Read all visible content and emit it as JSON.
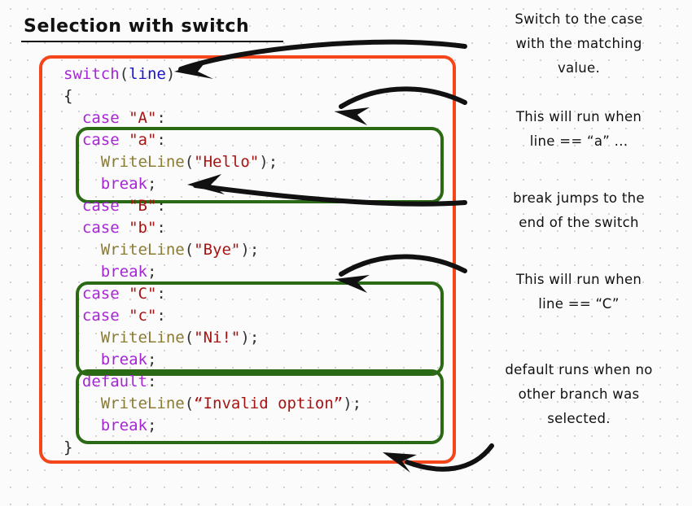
{
  "page": {
    "title": "Selection with switch",
    "background": "#fbfbfb",
    "grid_dot_color": "#cfcfcf"
  },
  "colors": {
    "outer_box_stroke": "#f4451b",
    "inner_box_stroke": "#2a6a14",
    "arrow": "#111111",
    "keyword": "#a626d4",
    "variable": "#1a13c8",
    "function": "#8a7b33",
    "string": "#a61414",
    "punctuation": "#333333",
    "text": "#111111"
  },
  "code": {
    "lines": [
      {
        "indent": 0,
        "tokens": [
          {
            "t": "switch",
            "c": "kw"
          },
          {
            "t": "(",
            "c": "pun"
          },
          {
            "t": "line",
            "c": "var"
          },
          {
            "t": ")",
            "c": "pun"
          }
        ]
      },
      {
        "indent": 0,
        "tokens": [
          {
            "t": "{",
            "c": "brace"
          }
        ]
      },
      {
        "indent": 1,
        "tokens": [
          {
            "t": "case ",
            "c": "kw"
          },
          {
            "t": "\"A\"",
            "c": "str"
          },
          {
            "t": ":",
            "c": "pun"
          }
        ]
      },
      {
        "indent": 1,
        "tokens": [
          {
            "t": "case ",
            "c": "kw"
          },
          {
            "t": "\"a\"",
            "c": "str"
          },
          {
            "t": ":",
            "c": "pun"
          }
        ]
      },
      {
        "indent": 2,
        "tokens": [
          {
            "t": "WriteLine",
            "c": "fn"
          },
          {
            "t": "(",
            "c": "pun"
          },
          {
            "t": "\"Hello\"",
            "c": "str"
          },
          {
            "t": ")",
            "c": "pun"
          },
          {
            "t": ";",
            "c": "pun"
          }
        ]
      },
      {
        "indent": 2,
        "tokens": [
          {
            "t": "break",
            "c": "kw"
          },
          {
            "t": ";",
            "c": "pun"
          }
        ]
      },
      {
        "indent": 1,
        "tokens": [
          {
            "t": "case ",
            "c": "kw"
          },
          {
            "t": "\"B\"",
            "c": "str"
          },
          {
            "t": ":",
            "c": "pun"
          }
        ]
      },
      {
        "indent": 1,
        "tokens": [
          {
            "t": "case ",
            "c": "kw"
          },
          {
            "t": "\"b\"",
            "c": "str"
          },
          {
            "t": ":",
            "c": "pun"
          }
        ]
      },
      {
        "indent": 2,
        "tokens": [
          {
            "t": "WriteLine",
            "c": "fn"
          },
          {
            "t": "(",
            "c": "pun"
          },
          {
            "t": "\"Bye\"",
            "c": "str"
          },
          {
            "t": ")",
            "c": "pun"
          },
          {
            "t": ";",
            "c": "pun"
          }
        ]
      },
      {
        "indent": 2,
        "tokens": [
          {
            "t": "break",
            "c": "kw"
          },
          {
            "t": ";",
            "c": "pun"
          }
        ]
      },
      {
        "indent": 1,
        "tokens": [
          {
            "t": "case ",
            "c": "kw"
          },
          {
            "t": "\"C\"",
            "c": "str"
          },
          {
            "t": ":",
            "c": "pun"
          }
        ]
      },
      {
        "indent": 1,
        "tokens": [
          {
            "t": "case ",
            "c": "kw"
          },
          {
            "t": "\"c\"",
            "c": "str"
          },
          {
            "t": ":",
            "c": "pun"
          }
        ]
      },
      {
        "indent": 2,
        "tokens": [
          {
            "t": "WriteLine",
            "c": "fn"
          },
          {
            "t": "(",
            "c": "pun"
          },
          {
            "t": "\"Ni!\"",
            "c": "str"
          },
          {
            "t": ")",
            "c": "pun"
          },
          {
            "t": ";",
            "c": "pun"
          }
        ]
      },
      {
        "indent": 2,
        "tokens": [
          {
            "t": "break",
            "c": "kw"
          },
          {
            "t": ";",
            "c": "pun"
          }
        ]
      },
      {
        "indent": 1,
        "tokens": [
          {
            "t": "default",
            "c": "kw"
          },
          {
            "t": ":",
            "c": "pun"
          }
        ]
      },
      {
        "indent": 2,
        "tokens": [
          {
            "t": "WriteLine",
            "c": "fn"
          },
          {
            "t": "(",
            "c": "pun"
          },
          {
            "t": "“Invalid option”",
            "c": "str"
          },
          {
            "t": ")",
            "c": "pun"
          },
          {
            "t": ";",
            "c": "pun"
          }
        ]
      },
      {
        "indent": 2,
        "tokens": [
          {
            "t": "break",
            "c": "kw"
          },
          {
            "t": ";",
            "c": "pun"
          }
        ]
      },
      {
        "indent": 0,
        "tokens": [
          {
            "t": "}",
            "c": "brace"
          }
        ]
      }
    ]
  },
  "annotations": [
    {
      "id": "note-switch",
      "lines": [
        "Switch to the case",
        "with the matching",
        "value."
      ]
    },
    {
      "id": "note-casea",
      "lines": [
        "This will run when",
        "line ==  “a” ..."
      ]
    },
    {
      "id": "note-break",
      "lines": [
        "break jumps to the",
        "end of the switch"
      ]
    },
    {
      "id": "note-casec",
      "lines": [
        "This will run when",
        "line ==  “C”"
      ]
    },
    {
      "id": "note-default",
      "lines": [
        "default runs when no",
        "other branch was",
        "selected."
      ]
    }
  ],
  "highlight_boxes": [
    {
      "name": "case-a-block",
      "label": "case \"a\" body"
    },
    {
      "name": "case-c-block",
      "label": "case \"C\"/\"c\" body"
    },
    {
      "name": "default-block",
      "label": "default body"
    }
  ],
  "arrows": [
    {
      "name": "arrow-to-switch",
      "points_to": "switch(line)"
    },
    {
      "name": "arrow-to-case-a",
      "points_to": "case \"a\" block"
    },
    {
      "name": "arrow-to-break",
      "points_to": "break;"
    },
    {
      "name": "arrow-to-case-c",
      "points_to": "case \"C\" block"
    },
    {
      "name": "arrow-to-default",
      "points_to": "end of switch"
    }
  ]
}
